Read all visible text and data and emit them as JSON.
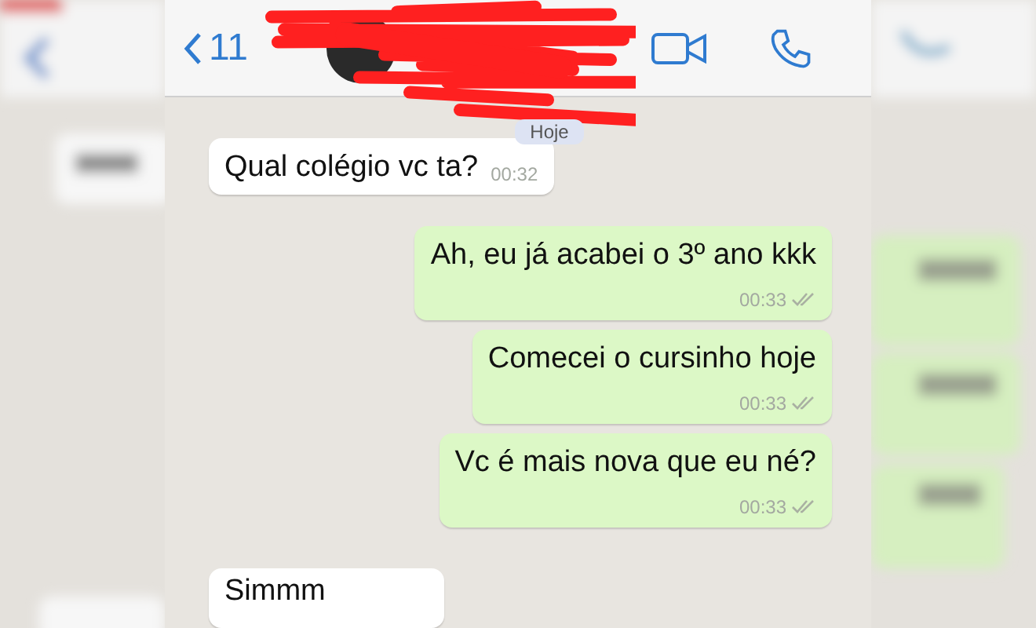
{
  "header": {
    "back_count": "11"
  },
  "date_chip": "Hoje",
  "messages": [
    {
      "kind": "incoming",
      "text": "Qual colégio vc ta?",
      "time": "00:32"
    },
    {
      "kind": "outgoing",
      "text": "Ah, eu já acabei o 3º ano kkk",
      "time": "00:33"
    },
    {
      "kind": "outgoing",
      "text": "Comecei o cursinho hoje",
      "time": "00:33"
    },
    {
      "kind": "outgoing",
      "text": "Vc é mais nova que eu né?",
      "time": "00:33"
    },
    {
      "kind": "incoming",
      "text": "Simmm"
    }
  ]
}
